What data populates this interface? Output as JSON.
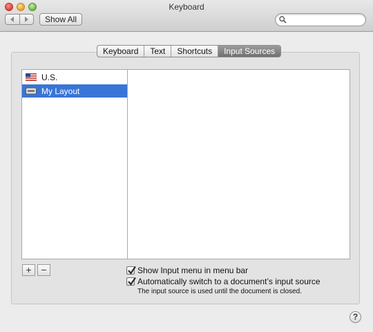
{
  "window": {
    "title": "Keyboard"
  },
  "toolbar": {
    "back_icon": "chevron-left-icon",
    "forward_icon": "chevron-right-icon",
    "show_all_label": "Show All",
    "search": {
      "placeholder": "",
      "value": "",
      "icon": "search-icon"
    }
  },
  "tabs": [
    {
      "label": "Keyboard",
      "selected": false
    },
    {
      "label": "Text",
      "selected": false
    },
    {
      "label": "Shortcuts",
      "selected": false
    },
    {
      "label": "Input Sources",
      "selected": true
    }
  ],
  "input_sources": {
    "items": [
      {
        "label": "U.S.",
        "icon": "us-flag-icon",
        "selected": false
      },
      {
        "label": "My Layout",
        "icon": "keyboard-layout-icon",
        "selected": true
      }
    ],
    "add_label": "+",
    "remove_label": "−"
  },
  "options": {
    "show_input_menu": {
      "label": "Show Input menu in menu bar",
      "checked": true
    },
    "auto_switch": {
      "label": "Automatically switch to a document’s input source",
      "checked": true
    },
    "note": "The input source is used until the document is closed."
  },
  "help_label": "?",
  "colors": {
    "selection": "#3875d7",
    "selected_tab": "#808080"
  }
}
